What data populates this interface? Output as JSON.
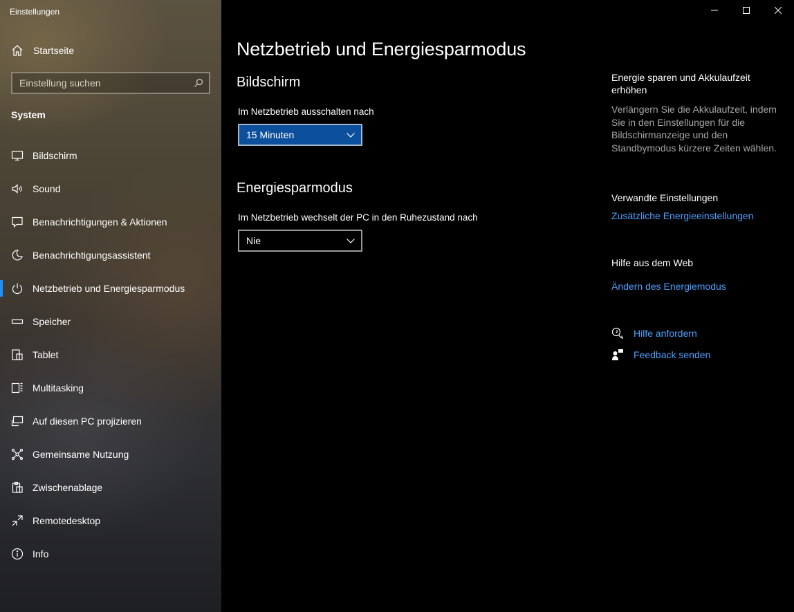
{
  "window": {
    "app_title": "Einstellungen"
  },
  "sidebar": {
    "home_label": "Startseite",
    "search_placeholder": "Einstellung suchen",
    "section": "System",
    "items": [
      {
        "label": "Bildschirm",
        "icon": "monitor-icon"
      },
      {
        "label": "Sound",
        "icon": "speaker-icon"
      },
      {
        "label": "Benachrichtigungen & Aktionen",
        "icon": "notification-icon"
      },
      {
        "label": "Benachrichtigungsassistent",
        "icon": "moon-icon"
      },
      {
        "label": "Netzbetrieb und Energiesparmodus",
        "icon": "power-icon",
        "active": true
      },
      {
        "label": "Speicher",
        "icon": "storage-icon"
      },
      {
        "label": "Tablet",
        "icon": "tablet-icon"
      },
      {
        "label": "Multitasking",
        "icon": "multitasking-icon"
      },
      {
        "label": "Auf diesen PC projizieren",
        "icon": "project-icon"
      },
      {
        "label": "Gemeinsame Nutzung",
        "icon": "share-icon"
      },
      {
        "label": "Zwischenablage",
        "icon": "clipboard-icon"
      },
      {
        "label": "Remotedesktop",
        "icon": "remote-desktop-icon"
      },
      {
        "label": "Info",
        "icon": "info-icon"
      }
    ]
  },
  "main": {
    "title": "Netzbetrieb und Energiesparmodus",
    "screen": {
      "heading": "Bildschirm",
      "label": "Im Netzbetrieb ausschalten nach",
      "value": "15 Minuten"
    },
    "sleep": {
      "heading": "Energiesparmodus",
      "label": "Im Netzbetrieb wechselt der PC in den Ruhezustand nach",
      "value": "Nie"
    }
  },
  "right": {
    "tip_title": "Energie sparen und Akkulaufzeit erhöhen",
    "tip_text": "Verlängern Sie die Akkulaufzeit, indem Sie in den Einstellungen für die Bildschirmanzeige und den Standbymodus kürzere Zeiten wählen.",
    "related_title": "Verwandte Einstellungen",
    "related_link": "Zusätzliche Energieeinstellungen",
    "web_title": "Hilfe aus dem Web",
    "web_link": "Ändern des Energiemodus",
    "help_link": "Hilfe anfordern",
    "feedback_link": "Feedback senden"
  },
  "colors": {
    "accent": "#1e90ff",
    "link": "#4ea1ff",
    "dropdown_focus": "#0c4f9c"
  }
}
